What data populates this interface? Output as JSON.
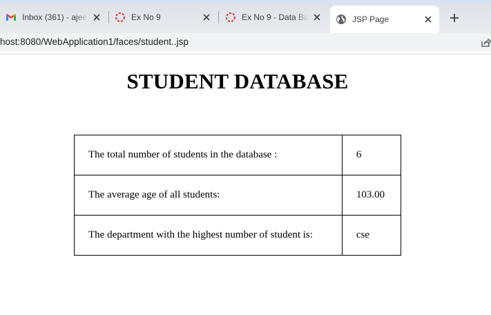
{
  "browser": {
    "tabs": [
      {
        "title": "Inbox (361) - ajee",
        "favicon": "gmail-icon",
        "active": false
      },
      {
        "title": "Ex No 9",
        "favicon": "loading-icon",
        "active": false
      },
      {
        "title": "Ex No 9 - Data Ba",
        "favicon": "loading-icon",
        "active": false
      },
      {
        "title": "JSP Page",
        "favicon": "globe-icon",
        "active": true
      }
    ],
    "new_tab_label": "+",
    "url": "host:8080/WebApplication1/faces/student..jsp"
  },
  "page": {
    "heading": "STUDENT DATABASE",
    "rows": [
      {
        "label": "The total number of students in the database :",
        "value": "6"
      },
      {
        "label": "The average age of all students:",
        "value": "103.00"
      },
      {
        "label": "The department with the highest number of student is:",
        "value": "cse"
      }
    ]
  },
  "colors": {
    "tabstrip": "#dee1e6",
    "active_tab": "#ffffff",
    "omnibox": "#f1f3f4",
    "loading_ring": "#d93025"
  }
}
